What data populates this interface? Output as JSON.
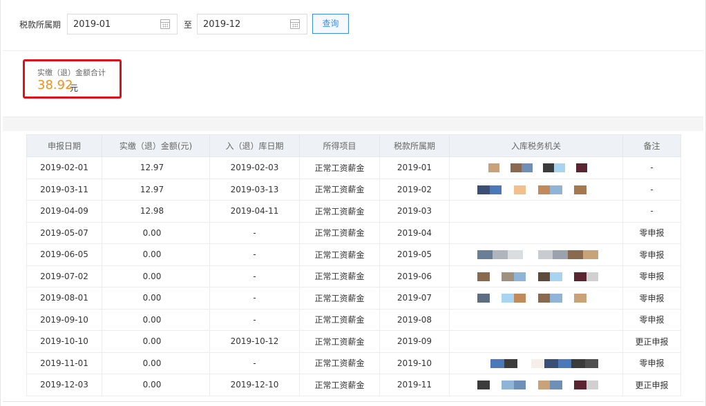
{
  "filter": {
    "label": "税款所属期",
    "start": "2019-01",
    "to_label": "至",
    "end": "2019-12",
    "query_label": "查询"
  },
  "summary": {
    "title": "实缴（退）金额合计",
    "amount": "38.92",
    "unit": "元"
  },
  "table": {
    "headers": [
      "申报日期",
      "实缴（退）金额(元)",
      "入（退）库日期",
      "所得项目",
      "税款所属期",
      "入库税务机关",
      "备注"
    ],
    "rows": [
      {
        "date": "2019-02-01",
        "amount": "12.97",
        "in_date": "2019-02-03",
        "item": "正常工资薪金",
        "period": "2019-01",
        "note": "-"
      },
      {
        "date": "2019-03-11",
        "amount": "12.97",
        "in_date": "2019-03-13",
        "item": "正常工资薪金",
        "period": "2019-02",
        "note": "-"
      },
      {
        "date": "2019-04-09",
        "amount": "12.98",
        "in_date": "2019-04-11",
        "item": "正常工资薪金",
        "period": "2019-03",
        "note": "-"
      },
      {
        "date": "2019-05-07",
        "amount": "0.00",
        "in_date": "-",
        "item": "正常工资薪金",
        "period": "2019-04",
        "note": "零申报"
      },
      {
        "date": "2019-06-05",
        "amount": "0.00",
        "in_date": "-",
        "item": "正常工资薪金",
        "period": "2019-05",
        "note": "零申报"
      },
      {
        "date": "2019-07-02",
        "amount": "0.00",
        "in_date": "-",
        "item": "正常工资薪金",
        "period": "2019-06",
        "note": "零申报"
      },
      {
        "date": "2019-08-01",
        "amount": "0.00",
        "in_date": "-",
        "item": "正常工资薪金",
        "period": "2019-07",
        "note": "零申报"
      },
      {
        "date": "2019-09-10",
        "amount": "0.00",
        "in_date": "-",
        "item": "正常工资薪金",
        "period": "2019-08",
        "note": "零申报"
      },
      {
        "date": "2019-10-10",
        "amount": "0.00",
        "in_date": "2019-10-12",
        "item": "正常工资薪金",
        "period": "2019-09",
        "note": "更正申报"
      },
      {
        "date": "2019-11-01",
        "amount": "0.00",
        "in_date": "-",
        "item": "正常工资薪金",
        "period": "2019-10",
        "note": "零申报"
      },
      {
        "date": "2019-12-03",
        "amount": "0.00",
        "in_date": "2019-12-10",
        "item": "正常工资薪金",
        "period": "2019-11",
        "note": "更正申报"
      }
    ]
  },
  "colors": {
    "accent": "#3a8ee6",
    "amount_orange": "#f39019",
    "highlight_red": "#e0101b"
  }
}
